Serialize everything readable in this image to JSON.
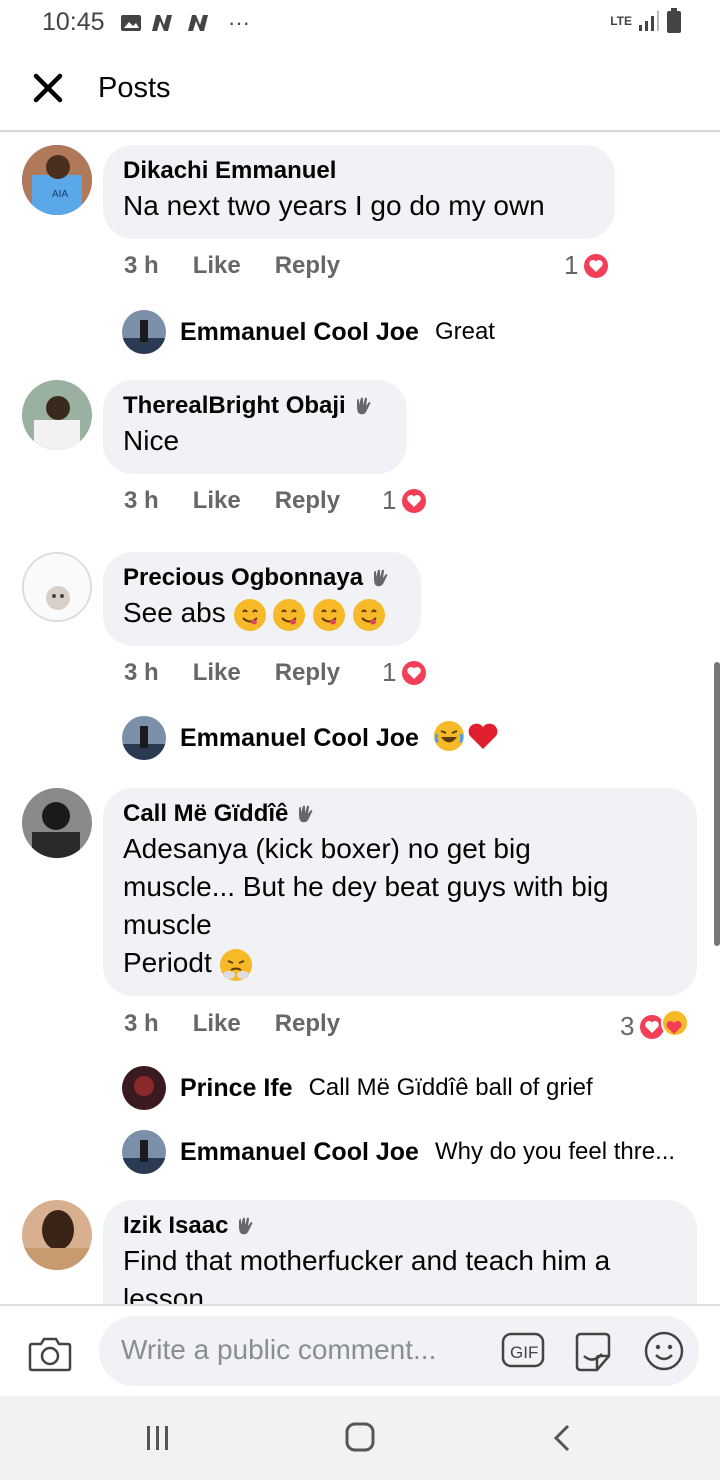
{
  "status": {
    "time": "10:45",
    "network": "LTE",
    "more": "···"
  },
  "header": {
    "title": "Posts",
    "close_icon": "close-icon"
  },
  "comments": [
    {
      "author": "Dikachi Emmanuel",
      "text": "Na next two years I go do my own",
      "time": "3 h",
      "like": "Like",
      "reply": "Reply",
      "reaction_count": "1",
      "replies": [
        {
          "author": "Emmanuel Cool Joe",
          "text": "Great"
        }
      ]
    },
    {
      "author": "TherealBright Obaji",
      "text": "Nice",
      "time": "3 h",
      "like": "Like",
      "reply": "Reply",
      "reaction_count": "1"
    },
    {
      "author": "Precious Ogbonnaya",
      "text": "See abs",
      "time": "3 h",
      "like": "Like",
      "reply": "Reply",
      "reaction_count": "1",
      "replies": [
        {
          "author": "Emmanuel Cool Joe",
          "text": ""
        }
      ]
    },
    {
      "author": "Call Më Gïddîê",
      "text_lines": [
        "Adesanya (kick boxer) no get big",
        "muscle... But he dey beat guys with big",
        "muscle",
        "Periodt"
      ],
      "time": "3 h",
      "like": "Like",
      "reply": "Reply",
      "reaction_count": "3",
      "replies": [
        {
          "author": "Prince Ife",
          "text": "Call Më Gïddîê ball of grief"
        },
        {
          "author": "Emmanuel Cool Joe",
          "text": "Why do you feel thre..."
        }
      ]
    },
    {
      "author": "Izik Isaac",
      "text": "Find that motherfucker and teach him a",
      "text2": "lesson"
    }
  ],
  "composer": {
    "placeholder": "Write a public comment...",
    "gif_label": "GIF"
  },
  "colors": {
    "heart": "#f33e58",
    "bubble": "#f0f2f5",
    "meta": "#65676b"
  }
}
